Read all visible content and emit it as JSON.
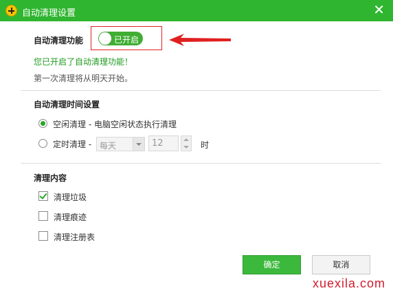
{
  "window": {
    "title": "自动清理设置",
    "close_glyph": "✕"
  },
  "auto_clean": {
    "label": "自动清理功能",
    "toggle_label": "已开启",
    "toggle_on": true,
    "enabled_message": "您已开启了自动清理功能！",
    "first_run_note": "第一次清理将从明天开始。"
  },
  "schedule": {
    "heading": "自动清理时间设置",
    "idle_option": "空闲清理 - 电脑空闲状态执行清理",
    "timed_option": "定时清理 -",
    "selected": "idle",
    "frequency_value": "每天",
    "hour_value": "12",
    "hour_unit": "时"
  },
  "content": {
    "heading": "清理内容",
    "items": [
      {
        "label": "清理垃圾",
        "checked": true
      },
      {
        "label": "清理痕迹",
        "checked": false
      },
      {
        "label": "清理注册表",
        "checked": false
      }
    ]
  },
  "buttons": {
    "ok": "确定",
    "cancel": "取消"
  },
  "watermark": "xuexila.com",
  "colors": {
    "titlebar": "#2fb52f",
    "accent_green": "#3cb93c",
    "message_green": "#1e9a1e",
    "annotation_red": "#e02020"
  }
}
